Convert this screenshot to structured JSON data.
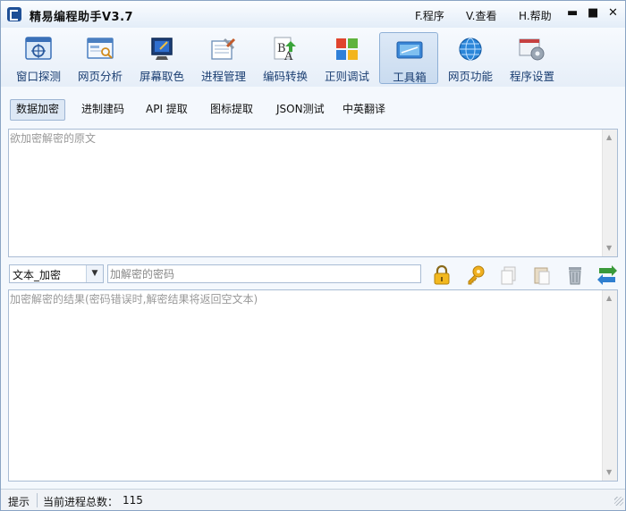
{
  "app": {
    "title": "精易编程助手V3.7",
    "icon": "app-logo-icon"
  },
  "menu": [
    {
      "label": "F.程序"
    },
    {
      "label": "V.查看"
    },
    {
      "label": "H.帮助"
    }
  ],
  "window_controls": {
    "minimize": "▬",
    "maximize": "■",
    "close": "✕"
  },
  "toolbar": [
    {
      "label": "窗口探测",
      "icon": "window-probe-icon"
    },
    {
      "label": "网页分析",
      "icon": "webpage-analysis-icon"
    },
    {
      "label": "屏幕取色",
      "icon": "color-picker-icon"
    },
    {
      "label": "进程管理",
      "icon": "process-manager-icon"
    },
    {
      "label": "编码转换",
      "icon": "encoding-convert-icon"
    },
    {
      "label": "正则调试",
      "icon": "regex-debug-icon"
    },
    {
      "label": "工具箱",
      "icon": "toolbox-icon",
      "active": true
    },
    {
      "label": "网页功能",
      "icon": "web-globe-icon"
    },
    {
      "label": "程序设置",
      "icon": "settings-icon"
    }
  ],
  "tabs": [
    {
      "label": "数据加密",
      "selected": true
    },
    {
      "label": "进制建码"
    },
    {
      "label": "API 提取"
    },
    {
      "label": "图标提取"
    },
    {
      "label": "JSON测试"
    },
    {
      "label": "中英翻译"
    }
  ],
  "source_text": {
    "placeholder": "欲加密解密的原文",
    "value": ""
  },
  "mode_select": {
    "value": "文本_加密"
  },
  "password": {
    "placeholder": "加解密的密码",
    "value": ""
  },
  "action_icons": [
    "lock-icon",
    "key-icon",
    "copy-icon",
    "paste-icon",
    "trash-icon",
    "swap-icon"
  ],
  "result_text": {
    "placeholder": "加密解密的结果(密码错误时,解密结果将返回空文本)",
    "value": ""
  },
  "status": {
    "hint": "提示",
    "process_label": "当前进程总数：",
    "process_count": "115"
  },
  "colors": {
    "accent": "#1a3e72",
    "border": "#a9bcd4",
    "window_bg": "#f4f8fd"
  }
}
